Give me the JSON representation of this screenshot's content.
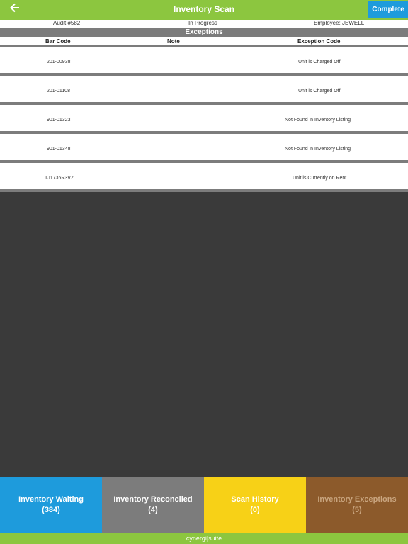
{
  "header": {
    "title": "Inventory Scan",
    "back_icon": "arrow-left-icon",
    "complete_label": "Complete"
  },
  "info": {
    "audit": "Audit #582",
    "status": "In Progress",
    "employee": "Employee: JEWELL"
  },
  "section_title": "Exceptions",
  "columns": {
    "bar_code": "Bar Code",
    "note": "Note",
    "exception_code": "Exception Code"
  },
  "rows": [
    {
      "bar_code": "201-00938",
      "note": "",
      "exception_code": "Unit is Charged Off"
    },
    {
      "bar_code": "201-01108",
      "note": "",
      "exception_code": "Unit is Charged Off"
    },
    {
      "bar_code": "901-01323",
      "note": "",
      "exception_code": "Not Found in Inventory Listing"
    },
    {
      "bar_code": "901-01348",
      "note": "",
      "exception_code": "Not Found in Inventory Listing"
    },
    {
      "bar_code": "TJ1736R3VZ",
      "note": "",
      "exception_code": "Unit is Currently on Rent"
    }
  ],
  "tiles": [
    {
      "label": "Inventory Waiting",
      "count": "(384)"
    },
    {
      "label": "Inventory Reconciled",
      "count": "(4)"
    },
    {
      "label": "Scan History",
      "count": "(0)"
    },
    {
      "label": "Inventory Exceptions",
      "count": "(5)"
    }
  ],
  "footer": "cynergi|suite",
  "colors": {
    "brand_green": "#8cc63f",
    "accent_blue": "#1e9bdc",
    "gray": "#7c7c7c",
    "yellow": "#f7d117",
    "brown": "#8c5a2b"
  }
}
